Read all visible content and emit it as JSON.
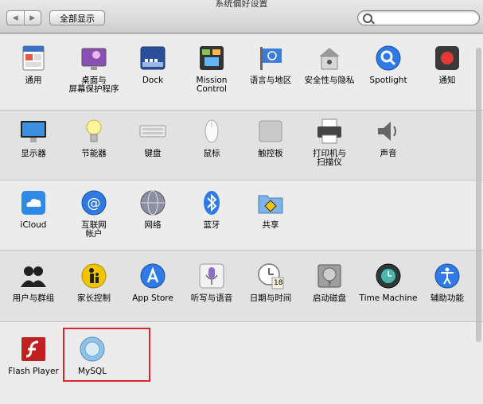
{
  "window": {
    "title": "系统偏好设置"
  },
  "toolbar": {
    "back": "◀",
    "forward": "▶",
    "show_all": "全部显示",
    "search_placeholder": ""
  },
  "sections": [
    {
      "items": [
        {
          "label": "通用",
          "icon": "general-icon"
        },
        {
          "label": "桌面与\n屏幕保护程序",
          "icon": "desktop-screensaver-icon"
        },
        {
          "label": "Dock",
          "icon": "dock-icon"
        },
        {
          "label": "Mission\nControl",
          "icon": "mission-control-icon"
        },
        {
          "label": "语言与地区",
          "icon": "language-region-icon"
        },
        {
          "label": "安全性与隐私",
          "icon": "security-privacy-icon"
        },
        {
          "label": "Spotlight",
          "icon": "spotlight-icon"
        },
        {
          "label": "通知",
          "icon": "notifications-icon"
        }
      ]
    },
    {
      "items": [
        {
          "label": "显示器",
          "icon": "displays-icon"
        },
        {
          "label": "节能器",
          "icon": "energy-saver-icon"
        },
        {
          "label": "键盘",
          "icon": "keyboard-icon"
        },
        {
          "label": "鼠标",
          "icon": "mouse-icon"
        },
        {
          "label": "触控板",
          "icon": "trackpad-icon"
        },
        {
          "label": "打印机与\n扫描仪",
          "icon": "printer-scanner-icon"
        },
        {
          "label": "声音",
          "icon": "sound-icon"
        }
      ]
    },
    {
      "items": [
        {
          "label": "iCloud",
          "icon": "icloud-icon"
        },
        {
          "label": "互联网\n帐户",
          "icon": "internet-accounts-icon"
        },
        {
          "label": "网络",
          "icon": "network-icon"
        },
        {
          "label": "蓝牙",
          "icon": "bluetooth-icon"
        },
        {
          "label": "共享",
          "icon": "sharing-icon"
        }
      ]
    },
    {
      "items": [
        {
          "label": "用户与群组",
          "icon": "users-groups-icon"
        },
        {
          "label": "家长控制",
          "icon": "parental-controls-icon"
        },
        {
          "label": "App Store",
          "icon": "app-store-icon"
        },
        {
          "label": "听写与语音",
          "icon": "dictation-speech-icon"
        },
        {
          "label": "日期与时间",
          "icon": "date-time-icon"
        },
        {
          "label": "启动磁盘",
          "icon": "startup-disk-icon"
        },
        {
          "label": "Time Machine",
          "icon": "time-machine-icon"
        },
        {
          "label": "辅助功能",
          "icon": "accessibility-icon"
        }
      ]
    },
    {
      "items": [
        {
          "label": "Flash Player",
          "icon": "flash-player-icon"
        },
        {
          "label": "MySQL",
          "icon": "mysql-icon"
        }
      ]
    }
  ],
  "icon_extras": {
    "calendar_day": "18"
  },
  "colors": {
    "highlight_box": "#d9262c"
  }
}
